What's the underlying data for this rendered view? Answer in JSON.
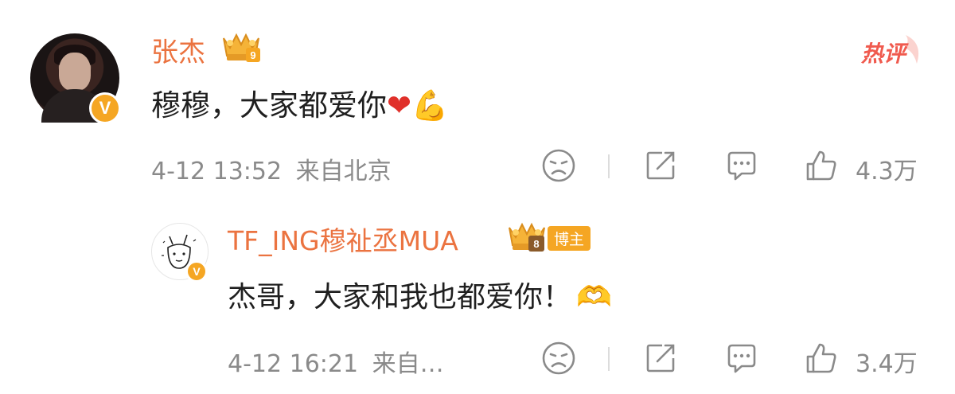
{
  "comment": {
    "username": "张杰",
    "level_badge": "9",
    "text": "穆穆，大家都爱你",
    "emoji_heart": "❤",
    "emoji_muscle": "💪",
    "timestamp": "4-12 13:52",
    "location": "来自北京",
    "hot_tag": "热评",
    "like_count": "4.3万"
  },
  "reply": {
    "username": "TF_ING穆祉丞MUA",
    "level_badge": "8",
    "role_tag": "博主",
    "text": "杰哥，大家和我也都爱你！",
    "emoji_heart_hands": "🫶",
    "timestamp": "4-12 16:21",
    "location": "来自…",
    "like_count": "3.4万"
  },
  "icons": {
    "dislike": "sad-face-icon",
    "share": "share-icon",
    "reply": "comment-icon",
    "like": "thumbs-up-icon"
  },
  "colors": {
    "username": "#eb7340",
    "badge": "#f5a623",
    "hot_tag": "#f05a4e",
    "meta": "#8a8a8a"
  }
}
